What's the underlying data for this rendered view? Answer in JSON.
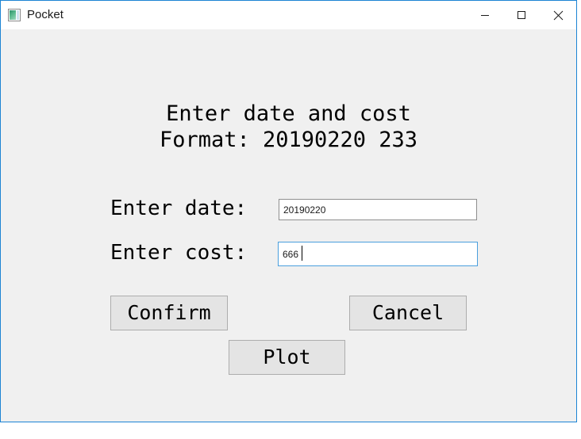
{
  "window": {
    "title": "Pocket",
    "icon": "app-image-icon",
    "frame_color": "#1c84d4",
    "titlebar_bg": "#ffffff",
    "client_bg": "#f0f0f0",
    "controls": {
      "minimize": "minimize-icon",
      "maximize": "maximize-icon",
      "close": "close-icon"
    }
  },
  "main": {
    "heading_line_1": "Enter date and cost",
    "heading_line_2": "Format: 20190220 233",
    "fields": [
      {
        "label": "Enter date:",
        "value": "20190220",
        "placeholder": "",
        "focused": false,
        "border_color": "#8e8e8e"
      },
      {
        "label": "Enter cost:",
        "value": "666",
        "placeholder": "",
        "focused": true,
        "border_color": "#4a9fdd"
      }
    ],
    "buttons": {
      "confirm": "Confirm",
      "cancel": "Cancel",
      "plot": "Plot"
    },
    "button_bg": "#e4e4e4",
    "button_border": "#adadad"
  }
}
